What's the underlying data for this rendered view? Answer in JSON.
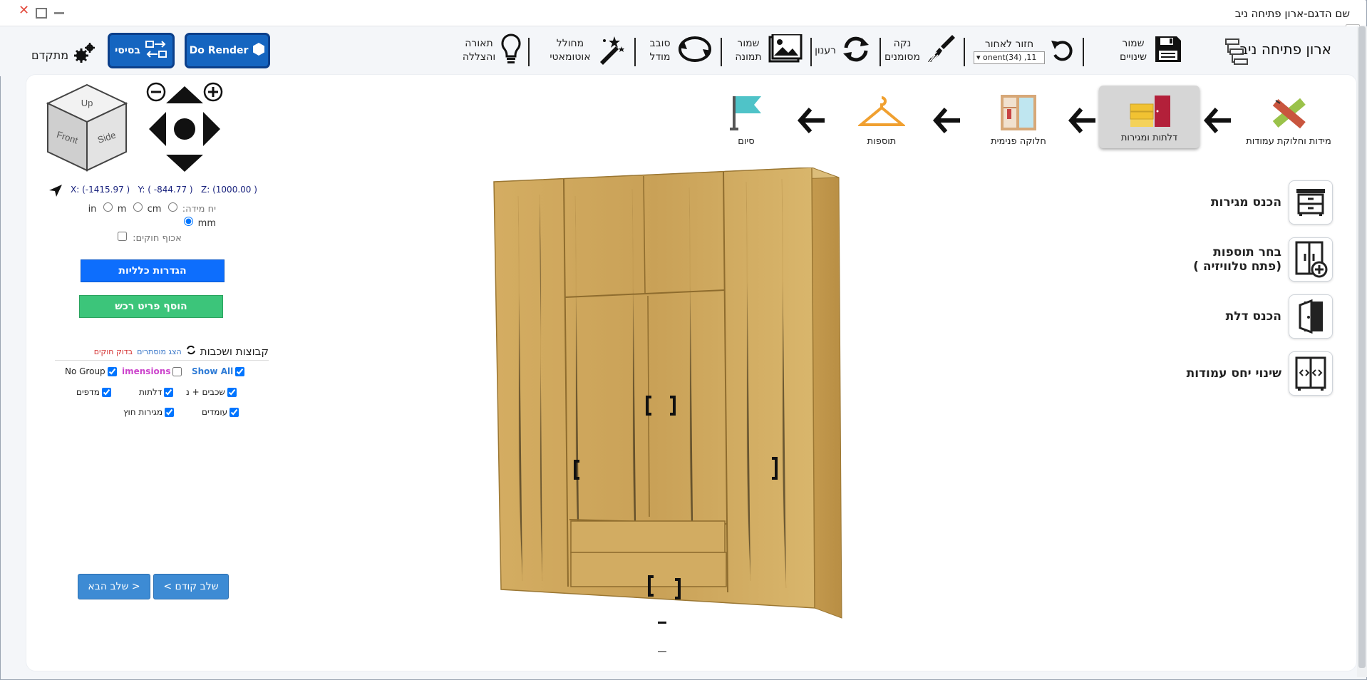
{
  "window": {
    "title": "שם הדגם-ארון פתיחה ניב"
  },
  "app": {
    "name": "ארון פתיחה ניב"
  },
  "toolbar": {
    "save": "שמור שינויים",
    "undo": "חזור לאחור",
    "undo_select": "onent(34) ,11",
    "clean": "נקה מסומנים",
    "refresh": "רענון",
    "save_image": "שמור תמונה",
    "rotate": "סובב מודל",
    "auto_gen": "מחולל אוטומאטי",
    "lighting": "תאורה והצללה",
    "render": "Do Render",
    "basic": "בסיסי",
    "advanced": "מתקדם"
  },
  "steps": [
    {
      "label": "מידות וחלוקת עמודות"
    },
    {
      "label": "דלתות ומגירות",
      "active": true
    },
    {
      "label": "חלוקה פנימית"
    },
    {
      "label": "תוספות"
    },
    {
      "label": "סיום"
    }
  ],
  "actions": [
    {
      "label": "הכנס מגירות",
      "icon": "drawers-icon"
    },
    {
      "label": "בחר תוספות (פתח טלוויזיה )",
      "icon": "cabinet-add-icon"
    },
    {
      "label": "הכנס דלת",
      "icon": "door-icon"
    },
    {
      "label": "שינוי יחס עמודות",
      "icon": "columns-ratio-icon"
    }
  ],
  "view_cube": {
    "up": "Up",
    "front": "Front",
    "side": "Side"
  },
  "coords": {
    "x": "X: (-1415.97 )",
    "y": "Y: ( -844.77 )",
    "z": "Z: (1000.00 )"
  },
  "units": {
    "label": "יח מידה:",
    "options": [
      "in",
      "m",
      "cm",
      "mm"
    ],
    "selected": "mm"
  },
  "rods_label": "אכוף חוקים:",
  "general_settings": "הגדרות כלליות",
  "add_furniture": "הוסף פריט רכש",
  "groups": {
    "title": "קבוצות ושכבות",
    "show_hidden": "הצג מוסתרים",
    "check_rules": "בדוק חוקים",
    "items": {
      "show_all": "Show All",
      "dimensions": "imensions",
      "no_group": "No Group",
      "layers": "שכבים + נ",
      "doors": "דלתות",
      "shelves": "מדפים",
      "columns": "עומדים",
      "ext_drawers": "מגירות חוץ"
    }
  },
  "nav": {
    "prev": "< שלב קודם",
    "next": "שלב הבא >"
  },
  "colors": {
    "accent": "#1565c0",
    "green": "#3cc57a",
    "wood": "#c9a45a"
  }
}
